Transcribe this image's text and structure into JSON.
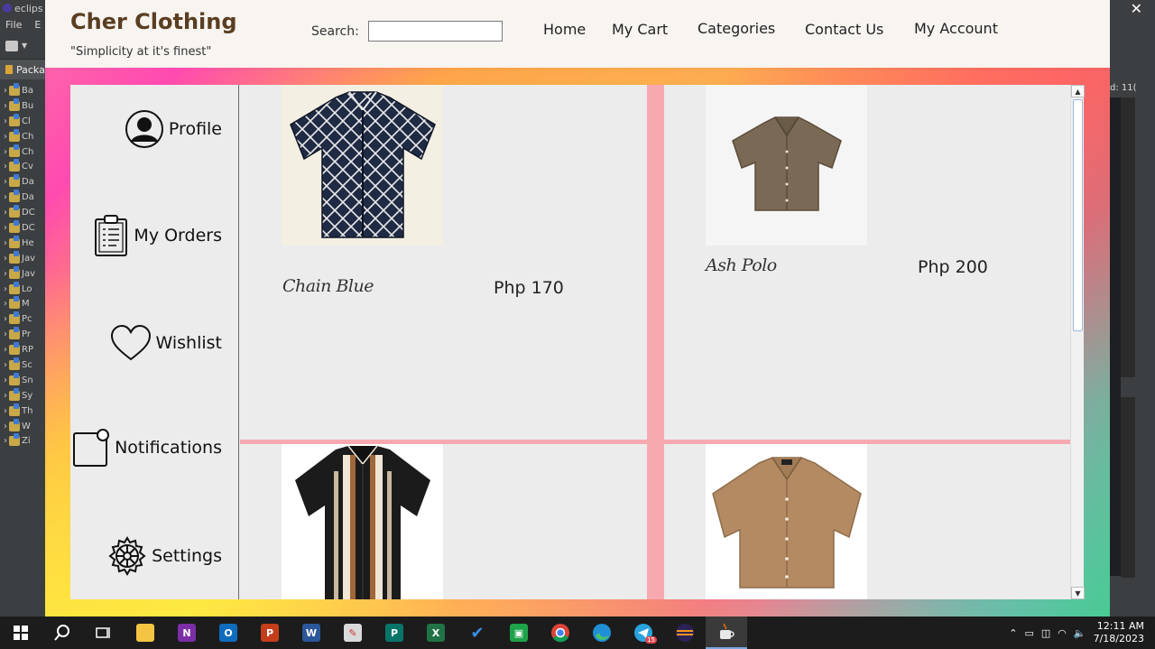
{
  "ide": {
    "title": "eclips",
    "menu": [
      "File",
      "E"
    ],
    "package_tab": "Packa",
    "tree_items": [
      "Ba",
      "Bu",
      "Cl",
      "Ch",
      "Ch",
      "Cv",
      "Da",
      "Da",
      "DC",
      "DC",
      "He",
      "Jav",
      "Jav",
      "Lo",
      "M",
      "Pc",
      "Pr",
      "RP",
      "Sc",
      "Sn",
      "Sy",
      "Th",
      "W",
      "Zi"
    ],
    "right_hint": "d: 11("
  },
  "header": {
    "brand": "Cher Clothing",
    "tagline": "\"Simplicity at it's finest\"",
    "search_label": "Search:",
    "search_value": "",
    "nav": [
      "Home",
      "My Cart",
      "Categories",
      "Contact Us",
      "My Account"
    ]
  },
  "sidebar": {
    "items": [
      {
        "label": "Profile",
        "icon": "profile-icon"
      },
      {
        "label": "My Orders",
        "icon": "clipboard-icon"
      },
      {
        "label": "Wishlist",
        "icon": "heart-icon"
      },
      {
        "label": "Notifications",
        "icon": "notification-icon"
      },
      {
        "label": "Settings",
        "icon": "gear-icon"
      }
    ]
  },
  "products": [
    {
      "name": "Chain Blue",
      "price": "Php 170",
      "color": "#1f2a44"
    },
    {
      "name": "Ash Polo",
      "price": "Php 200",
      "color": "#7a6a55"
    },
    {
      "name": "",
      "price": "",
      "color": "#1b1b1b"
    },
    {
      "name": "",
      "price": "",
      "color": "#b38a62"
    }
  ],
  "taskbar": {
    "apps": [
      "start",
      "search",
      "task-view",
      "file-explorer",
      "onenote",
      "outlook",
      "powerpoint",
      "word",
      "paint",
      "publisher",
      "excel",
      "todo",
      "app-green",
      "chrome",
      "edge",
      "telegram",
      "eclipse",
      "java"
    ],
    "telegram_badge": "15",
    "time": "12:11 AM",
    "date": "7/18/2023"
  }
}
